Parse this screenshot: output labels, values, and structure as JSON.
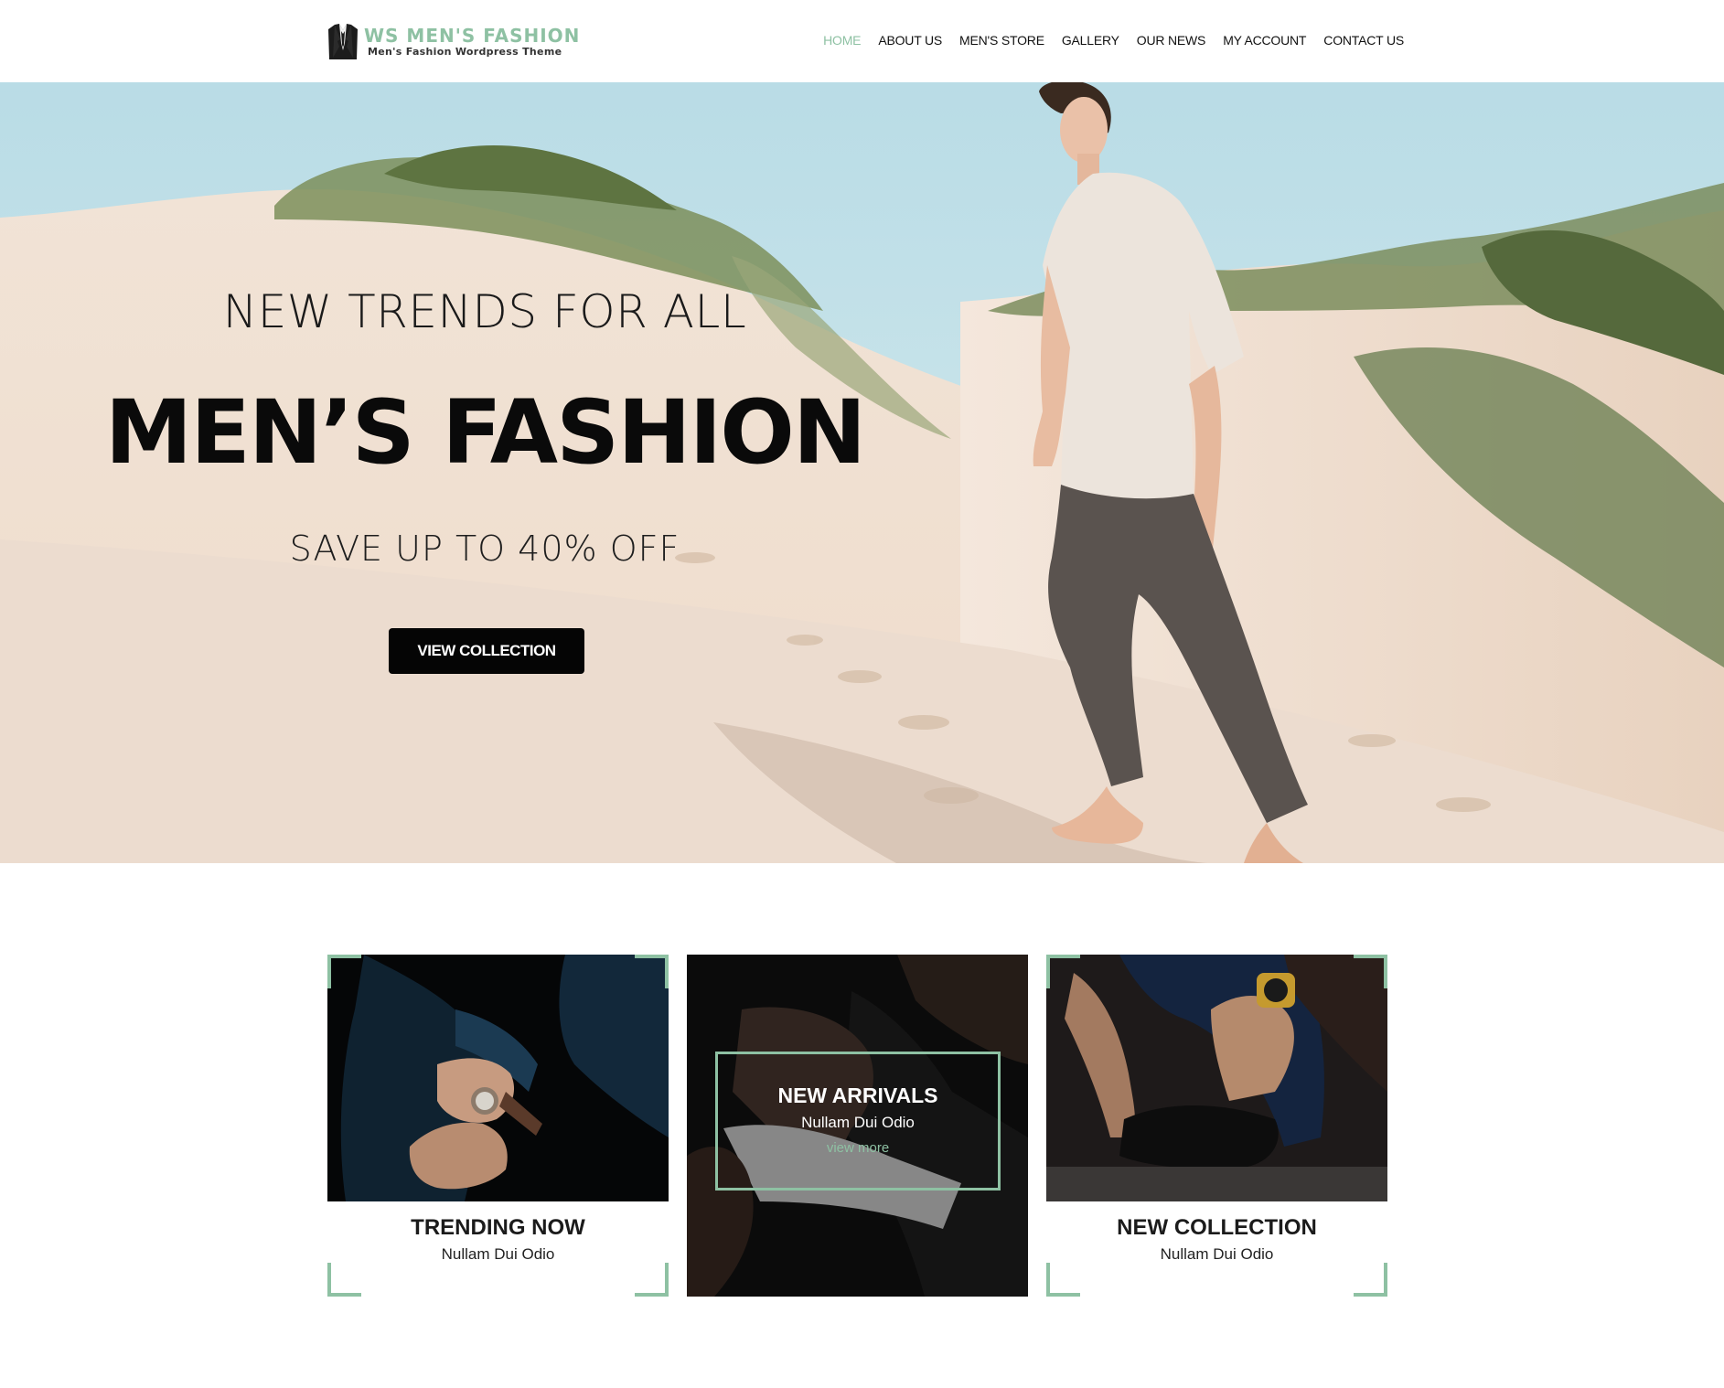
{
  "brand": {
    "title": "WS MEN'S FASHION",
    "tagline": "Men's Fashion Wordpress Theme",
    "icon": "jacket-icon",
    "accent_color": "#8ec1a3"
  },
  "nav": {
    "items": [
      {
        "label": "HOME",
        "active": true
      },
      {
        "label": "ABOUT US"
      },
      {
        "label": "MEN'S STORE"
      },
      {
        "label": "GALLERY"
      },
      {
        "label": "OUR NEWS"
      },
      {
        "label": "MY ACCOUNT"
      },
      {
        "label": "CONTACT US"
      }
    ]
  },
  "hero": {
    "eyebrow": "NEW TRENDS FOR ALL",
    "title": "MEN’S FASHION",
    "offer": "SAVE UP TO 40% OFF",
    "button_label": "VIEW COLLECTION"
  },
  "cards": [
    {
      "title": "TRENDING NOW",
      "subtitle": "Nullam Dui Odio"
    },
    {
      "title": "NEW ARRIVALS",
      "subtitle": "Nullam Dui Odio",
      "link": "view more"
    },
    {
      "title": "NEW COLLECTION",
      "subtitle": "Nullam Dui Odio"
    }
  ]
}
